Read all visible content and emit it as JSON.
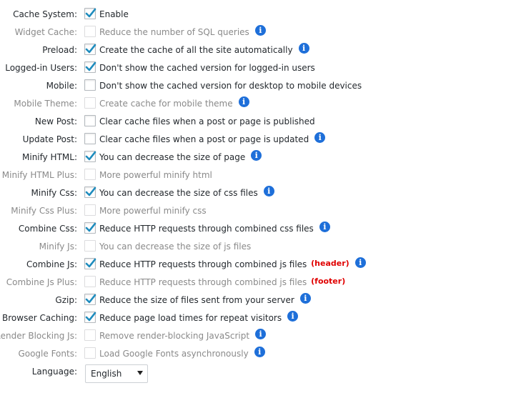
{
  "settings": [
    {
      "label": "Cache System:",
      "desc": "Enable",
      "checked": true,
      "disabled": false,
      "info": false,
      "tag": ""
    },
    {
      "label": "Widget Cache:",
      "desc": "Reduce the number of SQL queries",
      "checked": false,
      "disabled": true,
      "info": true,
      "tag": ""
    },
    {
      "label": "Preload:",
      "desc": "Create the cache of all the site automatically",
      "checked": true,
      "disabled": false,
      "info": true,
      "tag": ""
    },
    {
      "label": "Logged-in Users:",
      "desc": "Don't show the cached version for logged-in users",
      "checked": true,
      "disabled": false,
      "info": false,
      "tag": ""
    },
    {
      "label": "Mobile:",
      "desc": "Don't show the cached version for desktop to mobile devices",
      "checked": false,
      "disabled": false,
      "info": false,
      "tag": ""
    },
    {
      "label": "Mobile Theme:",
      "desc": "Create cache for mobile theme",
      "checked": false,
      "disabled": true,
      "info": true,
      "tag": ""
    },
    {
      "label": "New Post:",
      "desc": "Clear cache files when a post or page is published",
      "checked": false,
      "disabled": false,
      "info": false,
      "tag": ""
    },
    {
      "label": "Update Post:",
      "desc": "Clear cache files when a post or page is updated",
      "checked": false,
      "disabled": false,
      "info": true,
      "tag": ""
    },
    {
      "label": "Minify HTML:",
      "desc": "You can decrease the size of page",
      "checked": true,
      "disabled": false,
      "info": true,
      "tag": ""
    },
    {
      "label": "Minify HTML Plus:",
      "desc": "More powerful minify html",
      "checked": false,
      "disabled": true,
      "info": false,
      "tag": ""
    },
    {
      "label": "Minify Css:",
      "desc": "You can decrease the size of css files",
      "checked": true,
      "disabled": false,
      "info": true,
      "tag": ""
    },
    {
      "label": "Minify Css Plus:",
      "desc": "More powerful minify css",
      "checked": false,
      "disabled": true,
      "info": false,
      "tag": ""
    },
    {
      "label": "Combine Css:",
      "desc": "Reduce HTTP requests through combined css files",
      "checked": true,
      "disabled": false,
      "info": true,
      "tag": ""
    },
    {
      "label": "Minify Js:",
      "desc": "You can decrease the size of js files",
      "checked": false,
      "disabled": true,
      "info": false,
      "tag": ""
    },
    {
      "label": "Combine Js:",
      "desc": "Reduce HTTP requests through combined js files",
      "checked": true,
      "disabled": false,
      "info": true,
      "tag": "(header)"
    },
    {
      "label": "Combine Js Plus:",
      "desc": "Reduce HTTP requests through combined js files",
      "checked": false,
      "disabled": true,
      "info": false,
      "tag": "(footer)"
    },
    {
      "label": "Gzip:",
      "desc": "Reduce the size of files sent from your server",
      "checked": true,
      "disabled": false,
      "info": true,
      "tag": ""
    },
    {
      "label": "Browser Caching:",
      "desc": "Reduce page load times for repeat visitors",
      "checked": true,
      "disabled": false,
      "info": true,
      "tag": ""
    },
    {
      "label": "Render Blocking Js:",
      "desc": "Remove render-blocking JavaScript",
      "checked": false,
      "disabled": true,
      "info": true,
      "tag": ""
    },
    {
      "label": "Google Fonts:",
      "desc": "Load Google Fonts asynchronously",
      "checked": false,
      "disabled": true,
      "info": true,
      "tag": ""
    }
  ],
  "info_icon_glyph": "i",
  "info_icon_color": "#1e6fd9",
  "tag_color": "#e00000",
  "language": {
    "label": "Language:",
    "selected": "English"
  }
}
